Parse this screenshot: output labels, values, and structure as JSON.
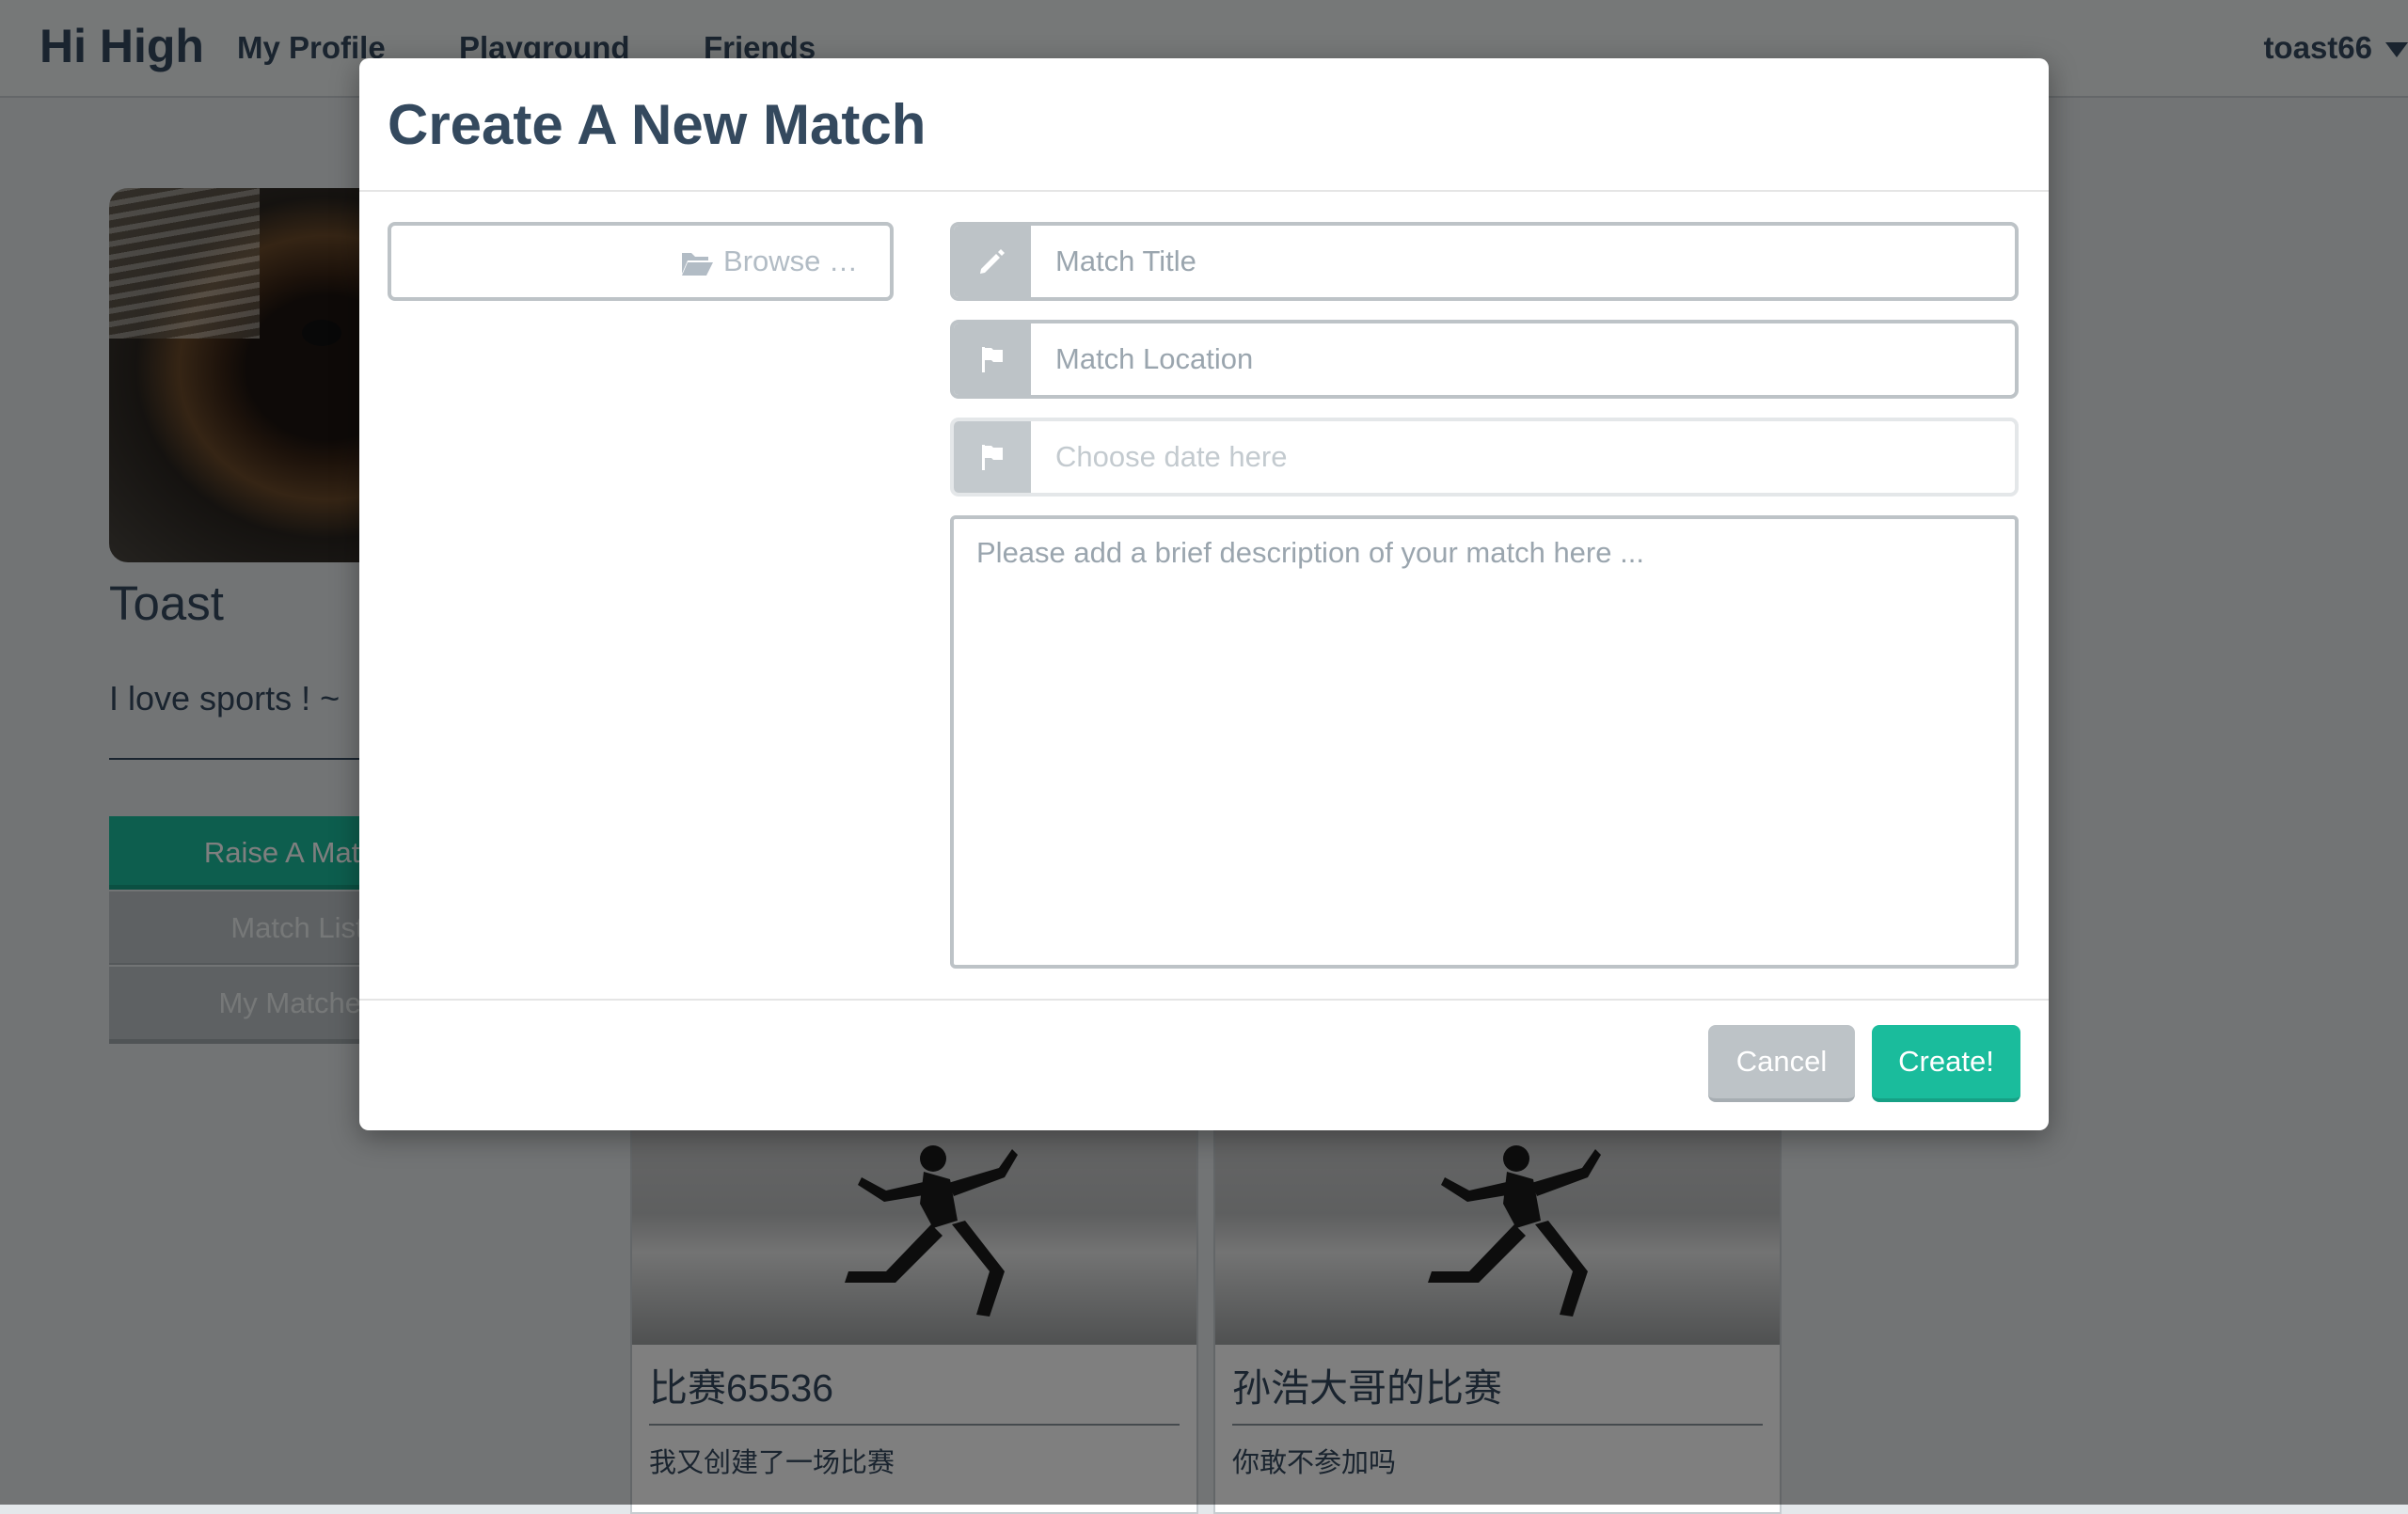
{
  "navbar": {
    "brand": "Hi High",
    "links": [
      "My Profile",
      "Playground",
      "Friends"
    ],
    "username": "toast66"
  },
  "profile": {
    "name": "Toast",
    "bio": "I love sports ! ~",
    "buttons": [
      "Raise A Match",
      "Match List",
      "My Matches"
    ]
  },
  "cards": [
    {
      "title": "比赛65536",
      "description": "我又创建了一场比赛"
    },
    {
      "title": "孙浩大哥的比赛",
      "description": "你敢不参加吗"
    }
  ],
  "modal": {
    "title": "Create A New Match",
    "browse_label": "Browse …",
    "match_title_placeholder": "Match Title",
    "match_location_placeholder": "Match Location",
    "date_placeholder": "Choose date here",
    "description_placeholder": "Please add a brief description of your match here ...",
    "cancel_label": "Cancel",
    "create_label": "Create!"
  },
  "colors": {
    "accent": "#1abc9c",
    "text": "#34495e",
    "muted": "#bdc3c7"
  },
  "icons": {
    "browse": "folder-open-icon",
    "title": "pencil-icon",
    "location": "flag-icon",
    "date": "flag-icon"
  }
}
